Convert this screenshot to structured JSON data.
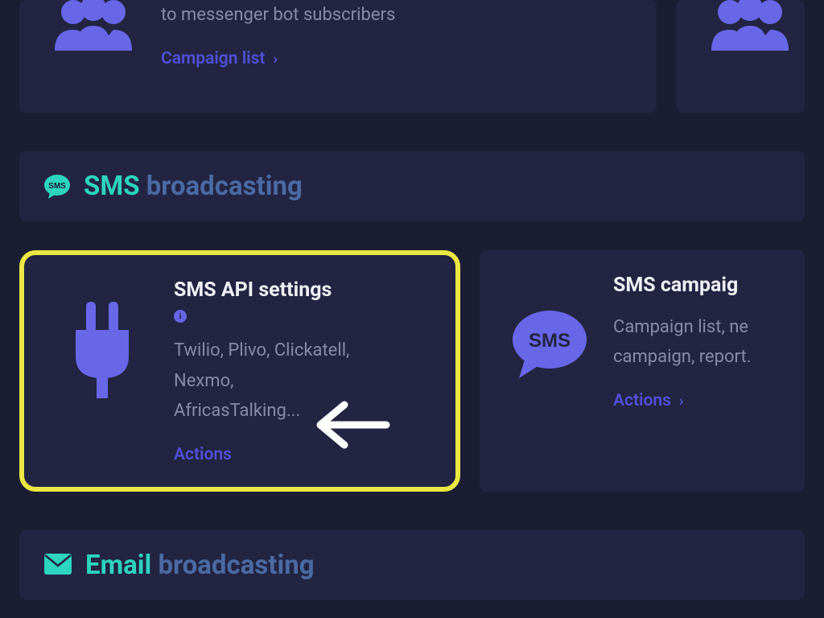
{
  "top_cards": {
    "left": {
      "desc": "to messenger bot subscribers",
      "link": "Campaign list"
    }
  },
  "sections": {
    "sms": {
      "first_word": "SMS",
      "rest": "broadcasting"
    },
    "email": {
      "first_word": "Email",
      "rest": "broadcasting"
    }
  },
  "sms_cards": {
    "api": {
      "title": "SMS API settings",
      "desc": "Twilio, Plivo, Clickatell, Nexmo, AfricasTalking...",
      "link": "Actions"
    },
    "campaign": {
      "title": "SMS campaig",
      "desc": "Campaign list, ne campaign, report.",
      "link": "Actions"
    }
  },
  "sms_bubble_text": "SMS",
  "colors": {
    "accent": "#6767e8",
    "teal": "#2dd4bf",
    "link": "#5050d8",
    "highlight": "#ebe844"
  }
}
